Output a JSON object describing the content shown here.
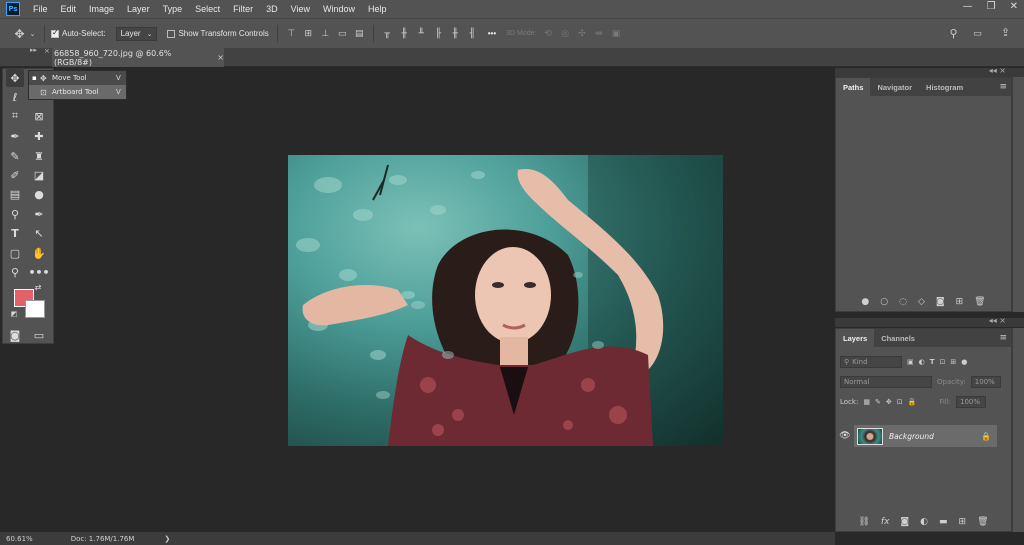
{
  "app": {
    "logo": "Ps"
  },
  "menu": [
    "File",
    "Edit",
    "Image",
    "Layer",
    "Type",
    "Select",
    "Filter",
    "3D",
    "View",
    "Window",
    "Help"
  ],
  "window_controls": {
    "minimize": "—",
    "restore": "❐",
    "close": "✕"
  },
  "options": {
    "auto_select_label": "Auto-Select:",
    "auto_select_value": "Layer",
    "transform_label": "Show Transform Controls",
    "mode_3d": "3D Mode:",
    "more": "•••"
  },
  "document": {
    "tab_title": "66858_960_720.jpg @ 60.6% (RGB/8#)",
    "tab_close": "×"
  },
  "flyout": {
    "items": [
      {
        "label": "Move Tool",
        "shortcut": "V",
        "icon": "move-icon"
      },
      {
        "label": "Artboard Tool",
        "shortcut": "V",
        "icon": "artboard-icon"
      }
    ]
  },
  "colors": {
    "foreground": "#e36169",
    "background": "#ffffff",
    "panel": "#535353",
    "accent": "#31a8ff"
  },
  "paths_panel": {
    "tabs": [
      "Paths",
      "Navigator",
      "Histogram"
    ],
    "active_tab": "Paths"
  },
  "layers_panel": {
    "tabs": [
      "Layers",
      "Channels"
    ],
    "active_tab": "Layers",
    "kind_placeholder": "Kind",
    "blend_mode": "Normal",
    "opacity_label": "Opacity:",
    "opacity_value": "100%",
    "lock_label": "Lock:",
    "fill_label": "Fill:",
    "fill_value": "100%",
    "layers": [
      {
        "name": "Background",
        "visible": true,
        "locked": true
      }
    ]
  },
  "status": {
    "zoom": "60.61%",
    "doc": "Doc: 1.76M/1.76M",
    "arrow": "❯"
  }
}
